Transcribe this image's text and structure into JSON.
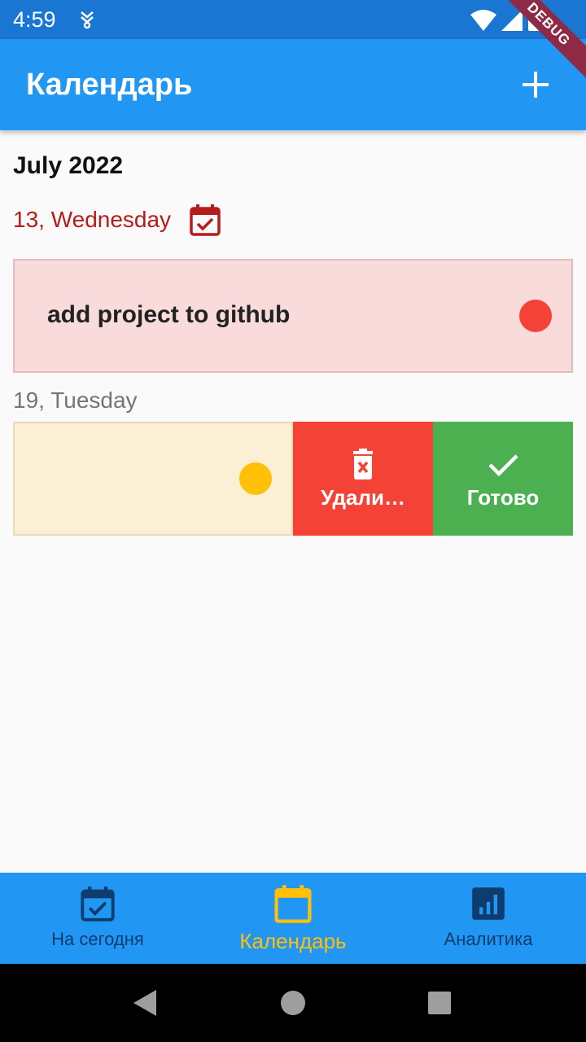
{
  "status_bar": {
    "time": "4:59"
  },
  "debug_banner": "DEBUG",
  "app_bar": {
    "title": "Календарь",
    "add_icon": "plus-icon"
  },
  "calendar": {
    "month": "July 2022",
    "groups": [
      {
        "date": "13, Wednesday",
        "is_today": true,
        "tasks": [
          {
            "title": "add project to github",
            "priority_color": "#f44336"
          }
        ]
      },
      {
        "date": "19, Tuesday",
        "is_today": false,
        "tasks": [
          {
            "title": "",
            "priority_color": "#ffc107",
            "swiped": true
          }
        ]
      }
    ]
  },
  "swipe_actions": {
    "delete_label": "Удали…",
    "done_label": "Готово"
  },
  "bottom_nav": {
    "items": [
      {
        "label": "На сегодня",
        "icon": "calendar-check-icon",
        "active": false
      },
      {
        "label": "Календарь",
        "icon": "calendar-icon",
        "active": true
      },
      {
        "label": "Аналитика",
        "icon": "analytics-icon",
        "active": false
      }
    ]
  },
  "colors": {
    "app_bar": "#2196f3",
    "status_bar": "#1976d2",
    "today_date": "#b71c1c",
    "delete": "#f44336",
    "done": "#4caf50",
    "nav_active": "#ffc107"
  }
}
